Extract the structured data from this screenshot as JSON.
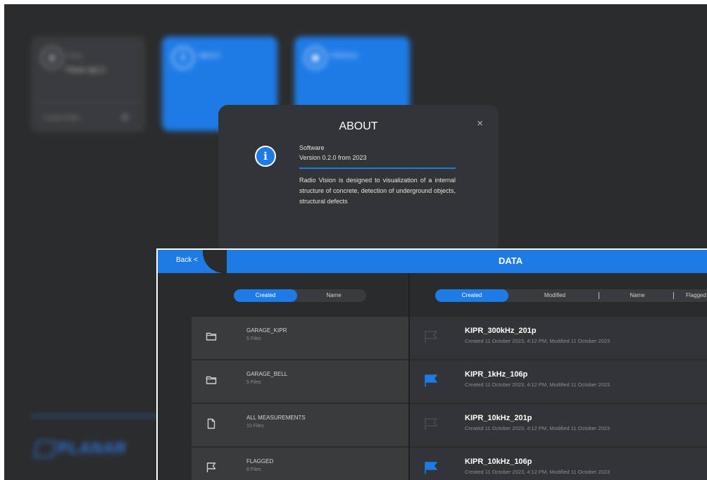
{
  "home": {
    "login": {
      "title": "Entry",
      "subtitle": "Please sign in",
      "new_folder": "Create folder"
    },
    "about_tile": {
      "label": "ABOUT"
    },
    "profile_tile": {
      "label": "PROFILE"
    },
    "logo_text": "PLANAR"
  },
  "about": {
    "title": "ABOUT",
    "close": "×",
    "software_label": "Software",
    "version": "Version 0.2.0 from 2023",
    "description": "Radio Vision is designed to visualization of a internal structure of concrete, detection of underground objects, structural defects"
  },
  "data_panel": {
    "back_label": "Back <",
    "title": "DATA",
    "folder_sort": {
      "created": "Created",
      "name": "Name"
    },
    "file_sort": {
      "created": "Created",
      "modified": "Modified",
      "name": "Name",
      "flagged": "Flagged"
    },
    "folders": [
      {
        "name": "GARAGE_KIPR",
        "count": "5 Files",
        "icon": "folder-icon"
      },
      {
        "name": "GARAGE_BELL",
        "count": "5 Files",
        "icon": "folder-icon"
      },
      {
        "name": "ALL MEASUREMENTS",
        "count": "10 Files",
        "icon": "file-icon"
      },
      {
        "name": "FLAGGED",
        "count": "8 Files",
        "icon": "flag-outline-icon"
      }
    ],
    "files": [
      {
        "name": "KIPR_300kHz_201p",
        "meta": "Created 11 October 2023, 4:12 PM, Modified 11 October 2023",
        "flagged": false
      },
      {
        "name": "KIPR_1kHz_106p",
        "meta": "Created 11 October 2023, 4:12 PM, Modified 11 October 2023",
        "flagged": true
      },
      {
        "name": "KIPR_10kHz_201p",
        "meta": "Created 11 October 2023, 4:12 PM, Modified 11 October 2023",
        "flagged": false
      },
      {
        "name": "KIPR_10kHz_106p",
        "meta": "Created 11 October 2023, 4:12 PM, Modified 11 October 2023",
        "flagged": true
      }
    ]
  },
  "colors": {
    "accent": "#1e7be6",
    "background": "#2b2c2e",
    "modal": "#333437",
    "flag_off": "#4a4b4f"
  }
}
